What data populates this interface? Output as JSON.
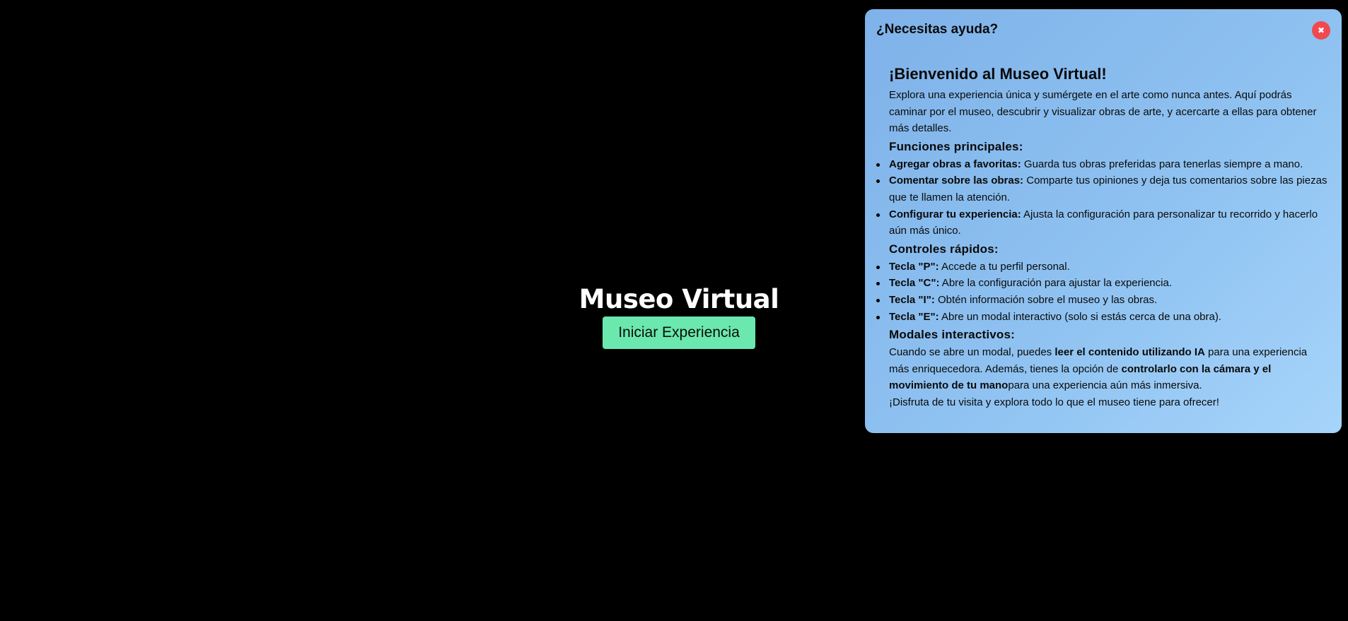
{
  "hero": {
    "title": "Museo Virtual",
    "start_button": "Iniciar Experiencia"
  },
  "help": {
    "header": "¿Necesitas ayuda?",
    "close_icon": "✖",
    "welcome_title": "¡Bienvenido al Museo Virtual!",
    "intro": "Explora una experiencia única y sumérgete en el arte como nunca antes. Aquí podrás caminar por el museo, descubrir y visualizar obras de arte, y acercarte a ellas para obtener más detalles.",
    "features_title": "Funciones principales:",
    "features": [
      {
        "label": "Agregar obras a favoritas:",
        "text": " Guarda tus obras preferidas para tenerlas siempre a mano."
      },
      {
        "label": "Comentar sobre las obras:",
        "text": " Comparte tus opiniones y deja tus comentarios sobre las piezas que te llamen la atención."
      },
      {
        "label": "Configurar tu experiencia:",
        "text": " Ajusta la configuración para personalizar tu recorrido y hacerlo aún más único."
      }
    ],
    "controls_title": "Controles rápidos:",
    "controls": [
      {
        "label": "Tecla \"P\":",
        "text": " Accede a tu perfil personal."
      },
      {
        "label": "Tecla \"C\":",
        "text": " Abre la configuración para ajustar la experiencia."
      },
      {
        "label": "Tecla \"I\":",
        "text": " Obtén información sobre el museo y las obras."
      },
      {
        "label": "Tecla \"E\":",
        "text": " Abre un modal interactivo (solo si estás cerca de una obra)."
      }
    ],
    "modals_title": "Modales interactivos:",
    "modals": {
      "p1": "Cuando se abre un modal, puedes ",
      "b1": "leer el contenido utilizando IA",
      "p2": " para una experiencia más enriquecedora. Además, tienes la opción de ",
      "b2": "controlarlo con la cámara y el movimiento de tu mano",
      "p3": "para una experiencia aún más inmersiva."
    },
    "closing": "¡Disfruta de tu visita y explora todo lo que el museo tiene para ofrecer!"
  },
  "colors": {
    "background": "#000000",
    "start_button": "#6ae8ad",
    "panel_gradient_start": "#7eb2e9",
    "panel_gradient_end": "#a6d4fa",
    "close_button": "#f0494f"
  }
}
